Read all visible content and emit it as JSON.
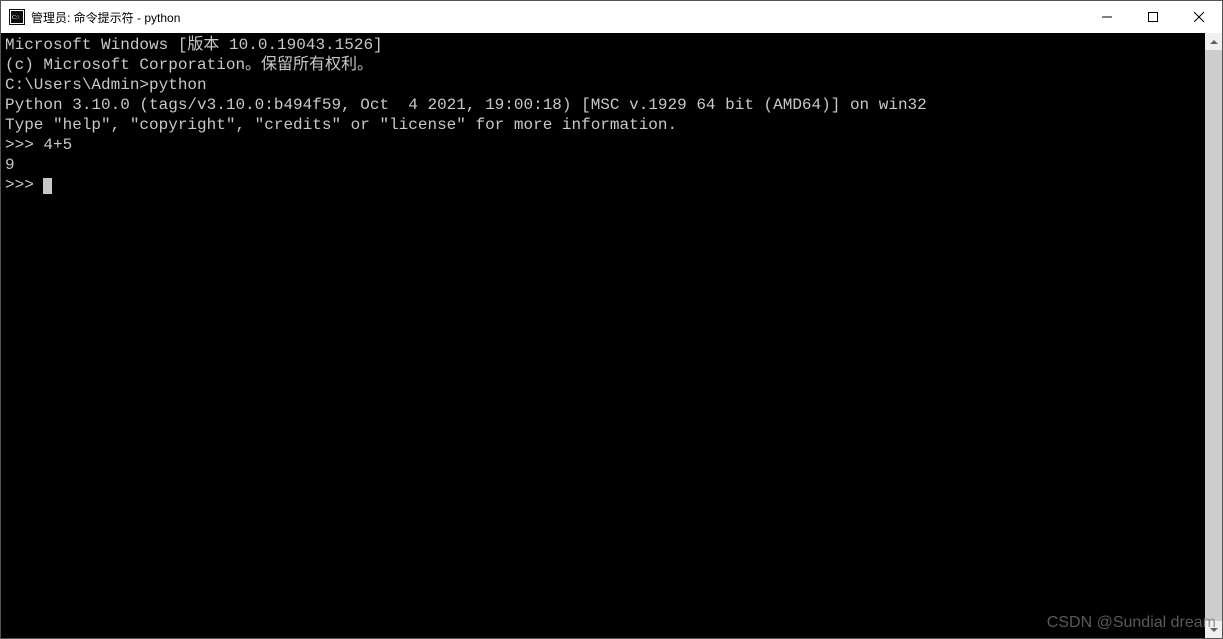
{
  "window": {
    "title": "管理员: 命令提示符 - python"
  },
  "terminal": {
    "lines": [
      "Microsoft Windows [版本 10.0.19043.1526]",
      "(c) Microsoft Corporation。保留所有权利。",
      "",
      "C:\\Users\\Admin>python",
      "Python 3.10.0 (tags/v3.10.0:b494f59, Oct  4 2021, 19:00:18) [MSC v.1929 64 bit (AMD64)] on win32",
      "Type \"help\", \"copyright\", \"credits\" or \"license\" for more information.",
      ">>> 4+5",
      "9",
      ">>> "
    ]
  },
  "watermark": "CSDN @Sundial dream"
}
